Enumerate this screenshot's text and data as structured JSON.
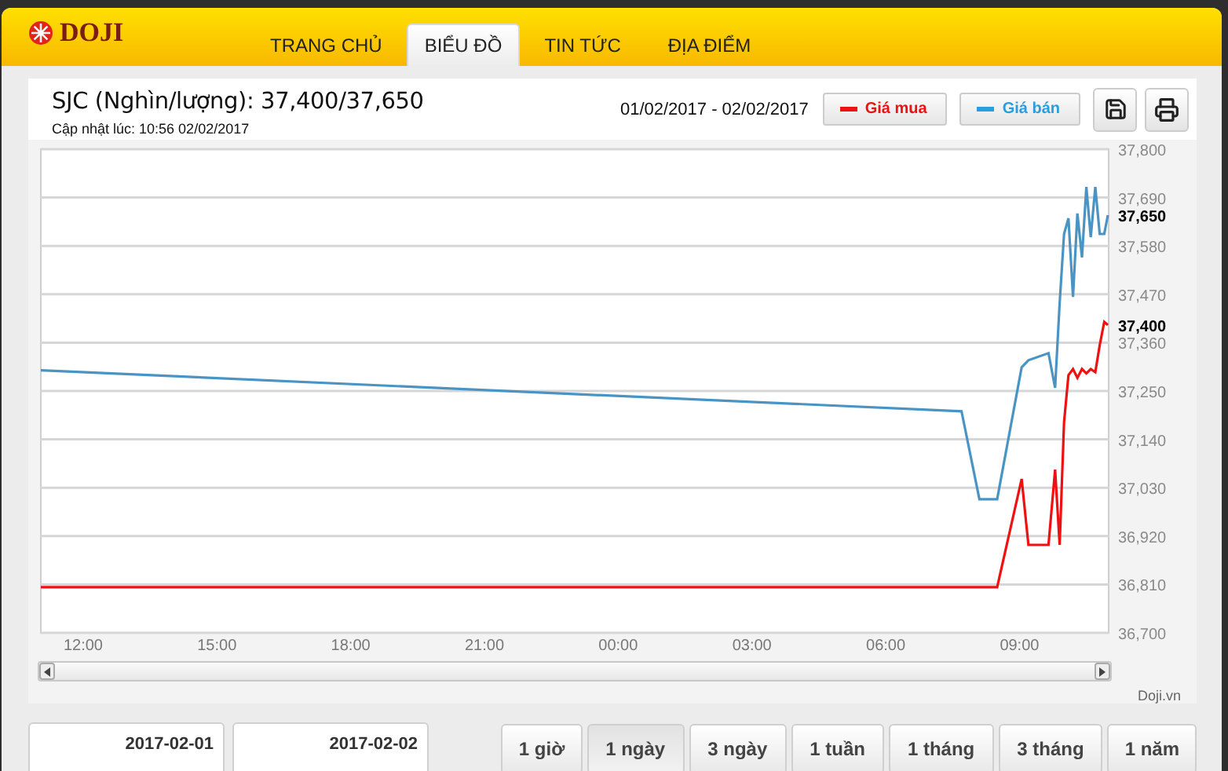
{
  "header": {
    "logo": "DOJI",
    "tabs": [
      {
        "label": "TRANG CHỦ",
        "selected": false
      },
      {
        "label": "BIỂU ĐỒ",
        "selected": true
      },
      {
        "label": "TIN TỨC",
        "selected": false
      },
      {
        "label": "ĐỊA ĐIỂM",
        "selected": false
      }
    ]
  },
  "panel": {
    "title": "SJC (Nghìn/lượng): 37,400/37,650",
    "updated": "Cập nhật lúc: 10:56 02/02/2017",
    "date_range": "01/02/2017 - 02/02/2017",
    "legend": [
      {
        "selected": true
      },
      {
        "selected": true
      }
    ],
    "credit": "Doji.vn",
    "chart_data": {
      "type": "line",
      "grid": true,
      "x": [
        "2017-02-01T11:03",
        "2017-02-02T07:42",
        "2017-02-02T08:06",
        "2017-02-02T08:30",
        "2017-02-02T09:03",
        "2017-02-02T09:12",
        "2017-02-02T09:39",
        "2017-02-02T09:48",
        "2017-02-02T09:54",
        "2017-02-02T10:00",
        "2017-02-02T10:06",
        "2017-02-02T10:12",
        "2017-02-02T10:18",
        "2017-02-02T10:24",
        "2017-02-02T10:30",
        "2017-02-02T10:36",
        "2017-02-02T10:42",
        "2017-02-02T10:48",
        "2017-02-02T10:54",
        "2017-02-02T10:59"
      ],
      "series": [
        {
          "name": "Giá mua",
          "color": "#ee1111",
          "values": [
            36804,
            36804,
            36804,
            36804,
            37050,
            36900,
            36900,
            37071,
            36900,
            37179,
            37286,
            37300,
            37280,
            37300,
            37290,
            37300,
            37293,
            37354,
            37407,
            37400
          ]
        },
        {
          "name": "Giá bán",
          "color": "#4a94c4",
          "values": [
            37297,
            37204,
            37004,
            37004,
            37304,
            37320,
            37336,
            37257,
            37450,
            37607,
            37643,
            37464,
            37654,
            37554,
            37714,
            37600,
            37714,
            37607,
            37607,
            37650
          ]
        }
      ],
      "xlim": [
        "2017-02-01T11:03",
        "2017-02-02T11:00"
      ],
      "ylim": [
        36700,
        37800
      ],
      "xticks": [
        {
          "value": "2017-02-01T12:00",
          "label": "12:00"
        },
        {
          "value": "2017-02-01T15:00",
          "label": "15:00"
        },
        {
          "value": "2017-02-01T18:00",
          "label": "18:00"
        },
        {
          "value": "2017-02-01T21:00",
          "label": "21:00"
        },
        {
          "value": "2017-02-02T00:00",
          "label": "00:00"
        },
        {
          "value": "2017-02-02T03:00",
          "label": "03:00"
        },
        {
          "value": "2017-02-02T06:00",
          "label": "06:00"
        },
        {
          "value": "2017-02-02T09:00",
          "label": "09:00"
        }
      ],
      "yticks": [
        {
          "value": 37800,
          "label": "37,800"
        },
        {
          "value": 37690,
          "label": "37,690"
        },
        {
          "value": 37580,
          "label": "37,580"
        },
        {
          "value": 37470,
          "label": "37,470"
        },
        {
          "value": 37360,
          "label": "37,360"
        },
        {
          "value": 37250,
          "label": "37,250"
        },
        {
          "value": 37140,
          "label": "37,140"
        },
        {
          "value": 37030,
          "label": "37,030"
        },
        {
          "value": 36920,
          "label": "36,920"
        },
        {
          "value": 36810,
          "label": "36,810"
        },
        {
          "value": 36700,
          "label": "36,700"
        }
      ],
      "annotations": [
        "37,400",
        "37,650"
      ]
    }
  },
  "date_fields": [
    {
      "value": "2017-02-01"
    },
    {
      "value": "2017-02-02"
    }
  ],
  "periods": [
    {
      "label": "1 giờ",
      "selected": false
    },
    {
      "label": "1 ngày",
      "selected": true
    },
    {
      "label": "3 ngày",
      "selected": false
    },
    {
      "label": "1 tuần",
      "selected": false
    },
    {
      "label": "1 tháng",
      "selected": false
    },
    {
      "label": "3 tháng",
      "selected": false
    },
    {
      "label": "1 năm",
      "selected": false
    }
  ]
}
